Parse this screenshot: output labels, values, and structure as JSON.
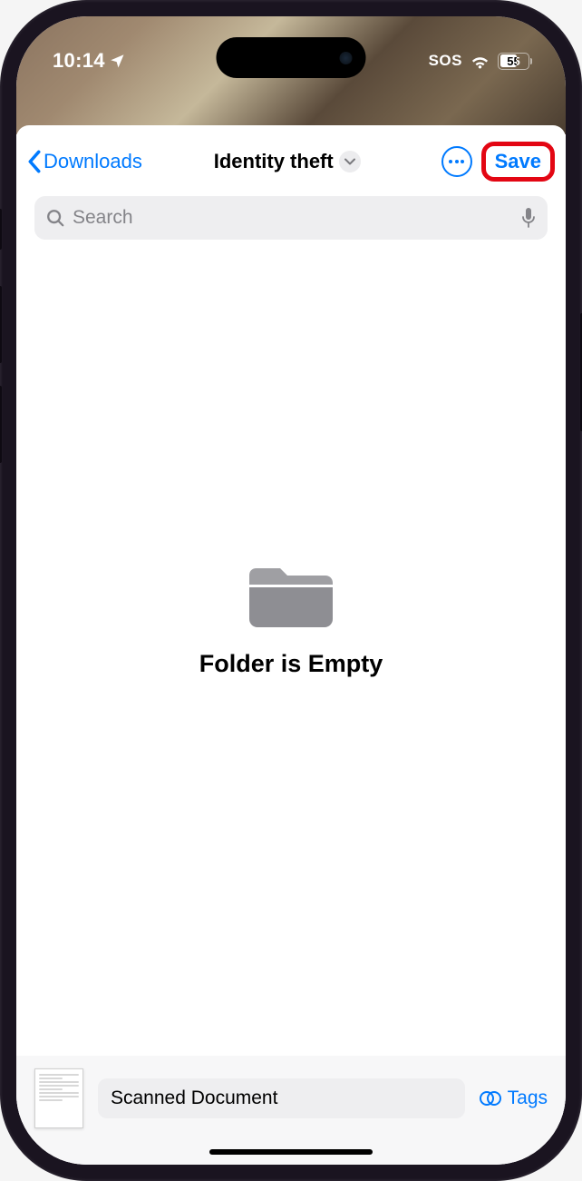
{
  "status": {
    "time": "10:14",
    "sos": "SOS",
    "battery": "55"
  },
  "nav": {
    "back_label": "Downloads",
    "title": "Identity theft",
    "save_label": "Save"
  },
  "search": {
    "placeholder": "Search"
  },
  "empty": {
    "message": "Folder is Empty"
  },
  "bottom": {
    "doc_name": "Scanned Document",
    "tags_label": "Tags"
  }
}
